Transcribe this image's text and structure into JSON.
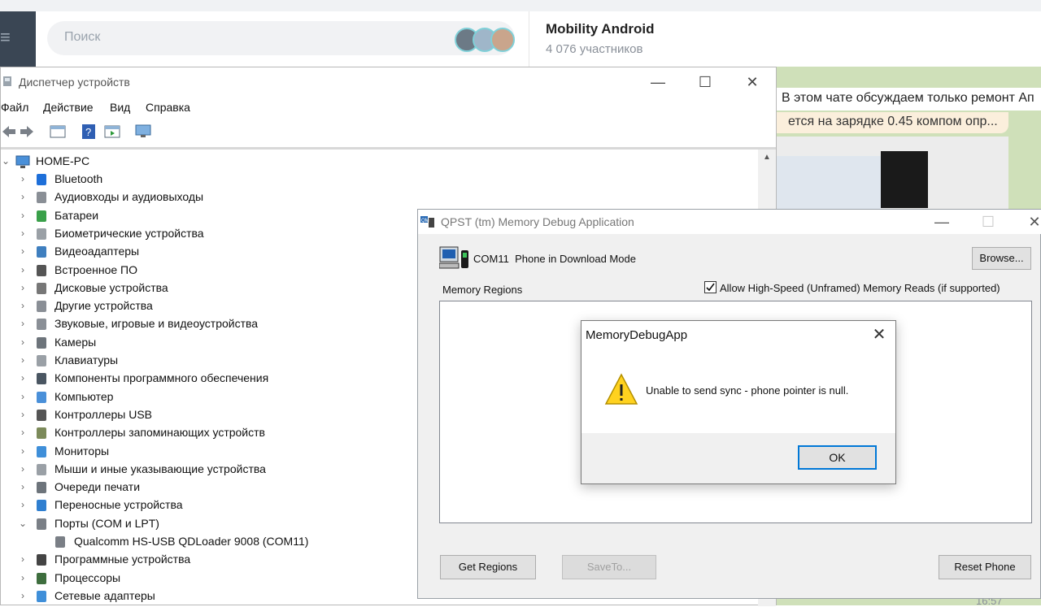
{
  "telegram": {
    "search_placeholder": "Поиск",
    "chat_title": "Mobility Android",
    "chat_subtitle": "4 076 участников",
    "message1": "В этом чате обсуждаем только ремонт Ап",
    "message2": "ется на зарядке 0.45 компом опр...",
    "time": "16:57"
  },
  "device_manager": {
    "title": "Диспетчер устройств",
    "menu": [
      "Файл",
      "Действие",
      "Вид",
      "Справка"
    ],
    "root": "HOME-PC",
    "items": [
      {
        "label": "Bluetooth",
        "icon": "bluetooth-icon"
      },
      {
        "label": "Аудиовходы и аудиовыходы",
        "icon": "speaker-icon"
      },
      {
        "label": "Батареи",
        "icon": "battery-icon"
      },
      {
        "label": "Биометрические устройства",
        "icon": "biometric-icon"
      },
      {
        "label": "Видеоадаптеры",
        "icon": "display-adapter-icon"
      },
      {
        "label": "Встроенное ПО",
        "icon": "firmware-icon"
      },
      {
        "label": "Дисковые устройства",
        "icon": "disk-drive-icon"
      },
      {
        "label": "Другие устройства",
        "icon": "unknown-device-icon"
      },
      {
        "label": "Звуковые, игровые и видеоустройства",
        "icon": "sound-icon"
      },
      {
        "label": "Камеры",
        "icon": "camera-icon"
      },
      {
        "label": "Клавиатуры",
        "icon": "keyboard-icon"
      },
      {
        "label": "Компоненты программного обеспечения",
        "icon": "software-component-icon"
      },
      {
        "label": "Компьютер",
        "icon": "computer-icon"
      },
      {
        "label": "Контроллеры USB",
        "icon": "usb-icon"
      },
      {
        "label": "Контроллеры запоминающих устройств",
        "icon": "storage-controller-icon"
      },
      {
        "label": "Мониторы",
        "icon": "monitor-icon"
      },
      {
        "label": "Мыши и иные указывающие устройства",
        "icon": "mouse-icon"
      },
      {
        "label": "Очереди печати",
        "icon": "printer-icon"
      },
      {
        "label": "Переносные устройства",
        "icon": "portable-device-icon"
      },
      {
        "label": "Порты (COM и LPT)",
        "icon": "port-icon"
      },
      {
        "label": "Qualcomm HS-USB QDLoader 9008 (COM11)",
        "icon": "port-icon"
      },
      {
        "label": "Программные устройства",
        "icon": "software-device-icon"
      },
      {
        "label": "Процессоры",
        "icon": "processor-icon"
      },
      {
        "label": "Сетевые адаптеры",
        "icon": "network-adapter-icon"
      }
    ]
  },
  "qpst": {
    "title": "QPST (tm) Memory Debug Application",
    "com_port": "COM11",
    "phone_status": "Phone in Download Mode",
    "browse": "Browse...",
    "memory_regions": "Memory Regions",
    "allow_highspeed": "Allow High-Speed (Unframed) Memory Reads (if supported)",
    "get_regions": "Get Regions",
    "save_to": "SaveTo...",
    "reset_phone": "Reset Phone"
  },
  "dialog": {
    "title": "MemoryDebugApp",
    "message": "Unable to send sync - phone pointer is null.",
    "ok": "OK"
  }
}
